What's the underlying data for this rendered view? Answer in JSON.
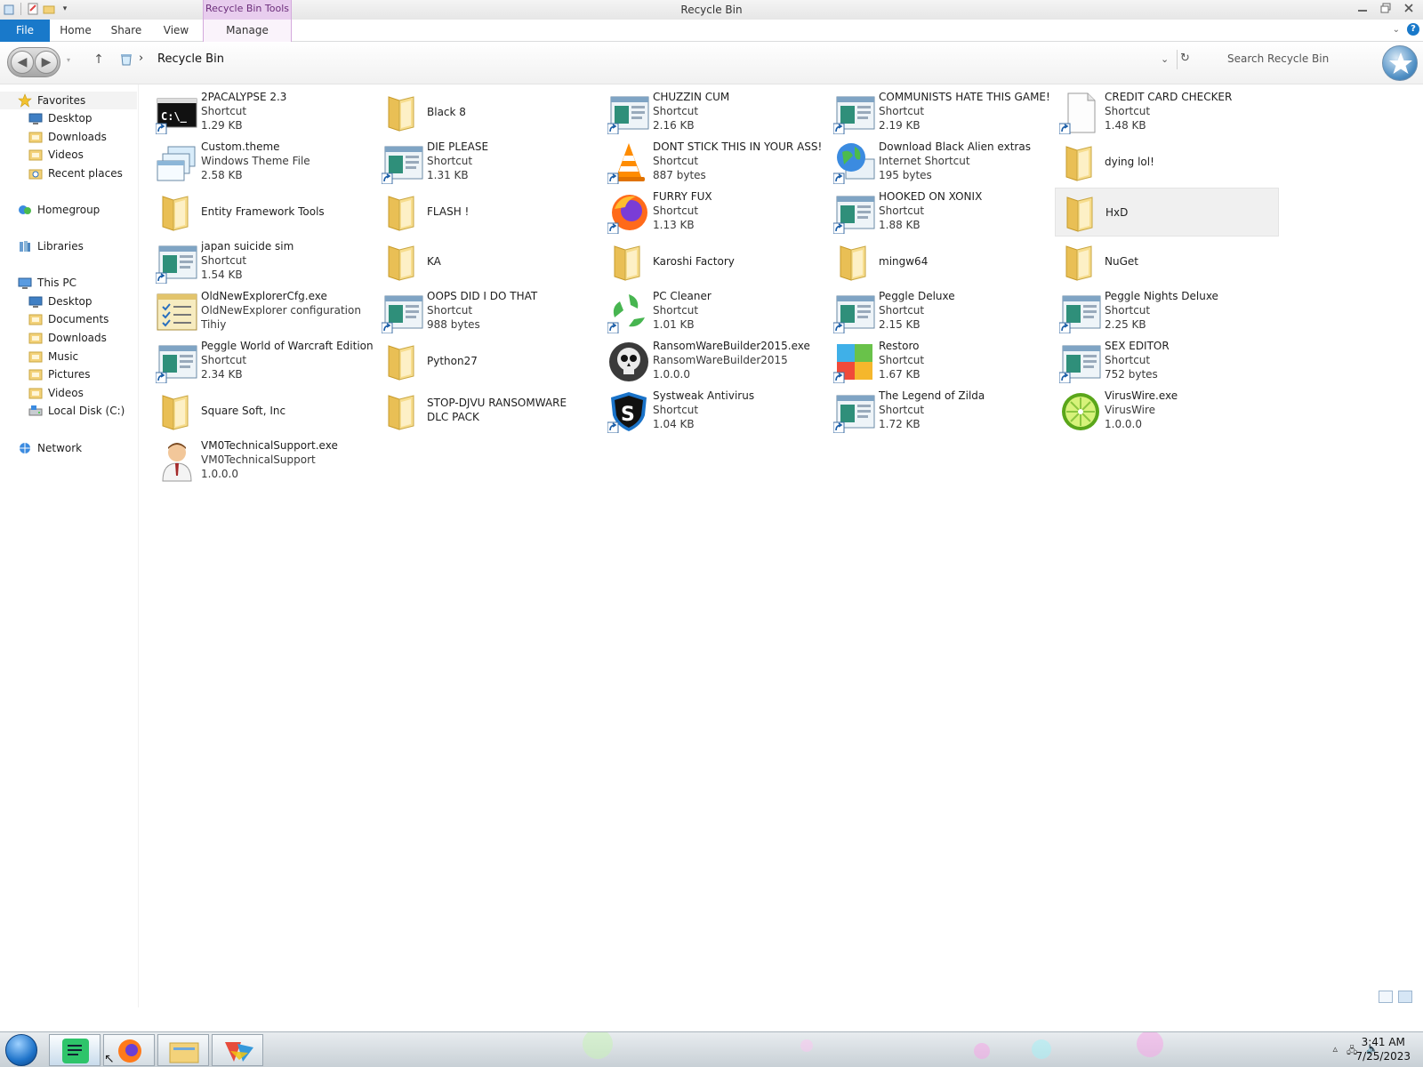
{
  "window": {
    "title": "Recycle Bin",
    "contextual_tab": "Recycle Bin Tools"
  },
  "ribbon": {
    "tabs": [
      "File",
      "Home",
      "Share",
      "View",
      "Manage"
    ]
  },
  "address": {
    "breadcrumb": "Recycle Bin",
    "search_placeholder": "Search Recycle Bin"
  },
  "sidebar": {
    "items": [
      {
        "label": "Favorites",
        "icon": "star-icon"
      },
      {
        "label": "Desktop",
        "icon": "desktop-icon"
      },
      {
        "label": "Downloads",
        "icon": "downloads-folder-icon"
      },
      {
        "label": "Videos",
        "icon": "videos-folder-icon"
      },
      {
        "label": "Recent places",
        "icon": "recent-places-icon"
      },
      {
        "label": "Homegroup",
        "icon": "homegroup-icon"
      },
      {
        "label": "Libraries",
        "icon": "libraries-icon"
      },
      {
        "label": "This PC",
        "icon": "computer-icon"
      },
      {
        "label": "Desktop",
        "icon": "desktop-icon"
      },
      {
        "label": "Documents",
        "icon": "documents-folder-icon"
      },
      {
        "label": "Downloads",
        "icon": "downloads-folder-icon"
      },
      {
        "label": "Music",
        "icon": "music-folder-icon"
      },
      {
        "label": "Pictures",
        "icon": "pictures-folder-icon"
      },
      {
        "label": "Videos",
        "icon": "videos-folder-icon"
      },
      {
        "label": "Local Disk (C:)",
        "icon": "drive-icon"
      },
      {
        "label": "Network",
        "icon": "network-icon"
      }
    ]
  },
  "files": [
    {
      "name": "2PACALYPSE 2.3",
      "type": "Shortcut",
      "size": "1.29 KB",
      "icon": "console-shortcut-icon"
    },
    {
      "name": "Black 8",
      "type": "",
      "size": "",
      "icon": "folder-icon"
    },
    {
      "name": "CHUZZIN CUM",
      "type": "Shortcut",
      "size": "2.16 KB",
      "icon": "app-shortcut-icon"
    },
    {
      "name": "COMMUNISTS HATE THIS GAME!",
      "type": "Shortcut",
      "size": "2.19 KB",
      "icon": "app-shortcut-icon"
    },
    {
      "name": "CREDIT CARD CHECKER",
      "type": "Shortcut",
      "size": "1.48 KB",
      "icon": "blank-shortcut-icon"
    },
    {
      "name": "Custom.theme",
      "type": "Windows Theme File",
      "size": "2.58 KB",
      "icon": "theme-file-icon"
    },
    {
      "name": "DIE PLEASE",
      "type": "Shortcut",
      "size": "1.31 KB",
      "icon": "app-shortcut-icon"
    },
    {
      "name": "DONT STICK THIS IN YOUR ASS!",
      "type": "Shortcut",
      "size": "887 bytes",
      "icon": "vlc-cone-icon"
    },
    {
      "name": "Download Black Alien extras",
      "type": "Internet Shortcut",
      "size": "195 bytes",
      "icon": "globe-shortcut-icon"
    },
    {
      "name": "dying lol!",
      "type": "",
      "size": "",
      "icon": "folder-icon"
    },
    {
      "name": "Entity Framework Tools",
      "type": "",
      "size": "",
      "icon": "folder-icon"
    },
    {
      "name": "FLASH !",
      "type": "",
      "size": "",
      "icon": "folder-icon"
    },
    {
      "name": "FURRY FUX",
      "type": "Shortcut",
      "size": "1.13 KB",
      "icon": "firefox-icon"
    },
    {
      "name": "HOOKED ON XONIX",
      "type": "Shortcut",
      "size": "1.88 KB",
      "icon": "app-shortcut-icon"
    },
    {
      "name": "HxD",
      "type": "",
      "size": "",
      "icon": "folder-icon"
    },
    {
      "name": "japan suicide sim",
      "type": "Shortcut",
      "size": "1.54 KB",
      "icon": "app-shortcut-icon"
    },
    {
      "name": "KA",
      "type": "",
      "size": "",
      "icon": "folder-icon"
    },
    {
      "name": "Karoshi Factory",
      "type": "",
      "size": "",
      "icon": "folder-icon"
    },
    {
      "name": "mingw64",
      "type": "",
      "size": "",
      "icon": "folder-icon"
    },
    {
      "name": "NuGet",
      "type": "",
      "size": "",
      "icon": "folder-icon"
    },
    {
      "name": "OldNewExplorerCfg.exe",
      "type": "OldNewExplorer configuration",
      "size": "Tihiy",
      "icon": "config-checklist-icon"
    },
    {
      "name": "OOPS DID I DO THAT",
      "type": "Shortcut",
      "size": "988 bytes",
      "icon": "app-shortcut-icon"
    },
    {
      "name": "PC Cleaner",
      "type": "Shortcut",
      "size": "1.01 KB",
      "icon": "recycle-leaf-icon"
    },
    {
      "name": "Peggle Deluxe",
      "type": "Shortcut",
      "size": "2.15 KB",
      "icon": "app-shortcut-icon"
    },
    {
      "name": "Peggle Nights Deluxe",
      "type": "Shortcut",
      "size": "2.25 KB",
      "icon": "app-shortcut-icon"
    },
    {
      "name": "Peggle World of Warcraft Edition",
      "type": "Shortcut",
      "size": "2.34 KB",
      "icon": "app-shortcut-icon"
    },
    {
      "name": "Python27",
      "type": "",
      "size": "",
      "icon": "folder-icon"
    },
    {
      "name": "RansomWareBuilder2015.exe",
      "type": "RansomWareBuilder2015",
      "size": "1.0.0.0",
      "icon": "skull-icon"
    },
    {
      "name": "Restoro",
      "type": "Shortcut",
      "size": "1.67 KB",
      "icon": "restoro-icon"
    },
    {
      "name": "SEX EDITOR",
      "type": "Shortcut",
      "size": "752 bytes",
      "icon": "app-shortcut-icon"
    },
    {
      "name": "Square Soft, Inc",
      "type": "",
      "size": "",
      "icon": "folder-icon"
    },
    {
      "name": "STOP-DJVU RANSOMWARE DLC PACK",
      "type": "",
      "size": "",
      "icon": "folder-icon"
    },
    {
      "name": "Systweak Antivirus",
      "type": "Shortcut",
      "size": "1.04 KB",
      "icon": "shield-s-icon"
    },
    {
      "name": "The Legend of Zilda",
      "type": "Shortcut",
      "size": "1.72 KB",
      "icon": "app-shortcut-icon"
    },
    {
      "name": "VirusWire.exe",
      "type": "VirusWire",
      "size": "1.0.0.0",
      "icon": "lime-icon"
    },
    {
      "name": "VM0TechnicalSupport.exe",
      "type": "VM0TechnicalSupport",
      "size": "1.0.0.0",
      "icon": "support-person-icon"
    }
  ],
  "taskbar": {
    "time": "3:41 AM",
    "date": "7/25/2023"
  },
  "colors": {
    "file_tab": "#1979ca",
    "contextual": "#e8cdee",
    "folder": "#f3d27a"
  }
}
